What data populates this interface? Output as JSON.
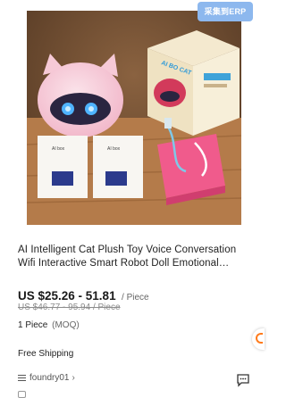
{
  "badge": {
    "label": "采集到ERP"
  },
  "product": {
    "title": "AI Intelligent Cat Plush Toy Voice Conversation Wifi Interactive Smart Robot Doll Emotional…",
    "price": "US $25.26 - 51.81",
    "price_unit": "/ Piece",
    "original_price": "US $46.77 - 95.94 / Piece",
    "moq_value": "1 Piece",
    "moq_label": "(MOQ)",
    "shipping": "Free Shipping",
    "store": "foundry01",
    "image": {
      "box_label": "AI BO CAT",
      "manual_title": "AI box"
    }
  },
  "colors": {
    "badge_bg": "#8db8ee",
    "accent": "#ff7a1a",
    "text": "#191919",
    "muted": "#8c8c8c"
  },
  "icons": {
    "menu": "menu-icon",
    "chat": "chat-icon",
    "chevron": "chevron-right-icon"
  }
}
